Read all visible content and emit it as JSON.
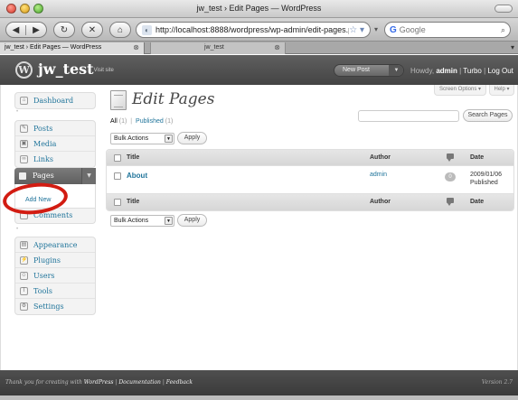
{
  "browser": {
    "window_title": "jw_test › Edit Pages — WordPress",
    "url": "http://localhost:8888/wordpress/wp-admin/edit-pages.php",
    "search_engine": "Google",
    "search_placeholder": "Google",
    "tabs": [
      {
        "label": "jw_test › Edit Pages — WordPress",
        "active": true
      },
      {
        "label": "jw_test",
        "active": false
      }
    ]
  },
  "header": {
    "site_name": "jw_test",
    "visit_site": "← Visit site",
    "new_post": "New Post",
    "howdy": "Howdy,",
    "username": "admin",
    "turbo": "Turbo",
    "logout": "Log Out",
    "sep": "|"
  },
  "screen_options": {
    "screen_label": "Screen Options ▾",
    "help_label": "Help ▾"
  },
  "sidebar": {
    "dashboard": "Dashboard",
    "posts": "Posts",
    "media": "Media",
    "links": "Links",
    "pages": "Pages",
    "add_new": "Add New",
    "comments": "Comments",
    "appearance": "Appearance",
    "plugins": "Plugins",
    "users": "Users",
    "tools": "Tools",
    "settings": "Settings"
  },
  "main": {
    "title": "Edit Pages",
    "filters": {
      "all": "All",
      "all_count": "(1)",
      "published": "Published",
      "published_count": "(1)",
      "sep": "|"
    },
    "search_button": "Search Pages",
    "bulk_actions": "Bulk Actions",
    "apply": "Apply",
    "columns": {
      "title": "Title",
      "author": "Author",
      "date": "Date"
    },
    "rows": [
      {
        "title": "About",
        "author": "admin",
        "comments": "0",
        "date": "2009/01/06",
        "status": "Published"
      }
    ]
  },
  "footer": {
    "thanks": "Thank you for creating with",
    "wordpress": "WordPress",
    "documentation": "Documentation",
    "feedback": "Feedback",
    "sep": "|",
    "version": "Version 2.7"
  },
  "colors": {
    "link": "#21759b",
    "header_bg": "#464646",
    "annotation_red": "#d21c12"
  }
}
